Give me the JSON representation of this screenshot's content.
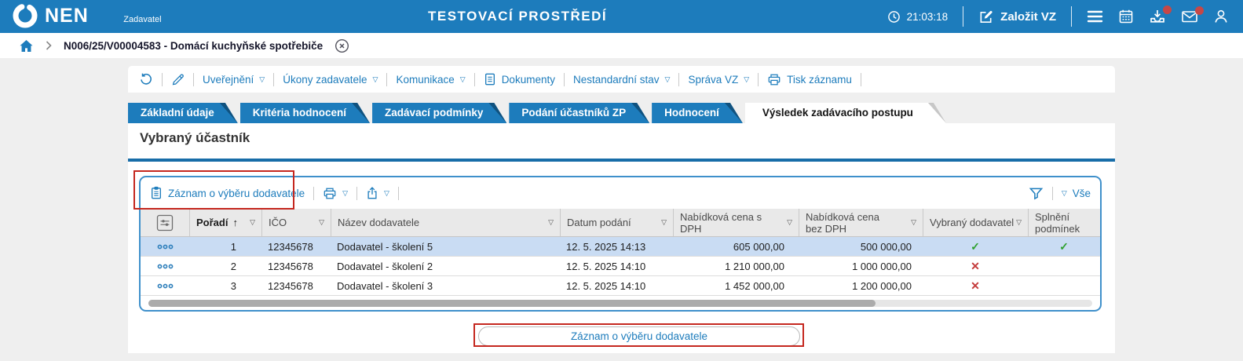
{
  "header": {
    "brand": "NEN",
    "brand_role": "Zadavatel",
    "environment": "TESTOVACÍ PROSTŘEDÍ",
    "clock": "21:03:18",
    "create_vz": "Založit VZ"
  },
  "breadcrumb": {
    "label": "N006/25/V00004583 - Domácí kuchyňské spotřebiče"
  },
  "actions": {
    "uverejneni": "Uveřejnění",
    "ukony_zadavatele": "Úkony zadavatele",
    "komunikace": "Komunikace",
    "dokumenty": "Dokumenty",
    "nestandardni_stav": "Nestandardní stav",
    "sprava_vz": "Správa VZ",
    "tisk_zaznamu": "Tisk záznamu"
  },
  "tabs": [
    {
      "label": "Základní údaje",
      "active": false
    },
    {
      "label": "Kritéria hodnocení",
      "active": false
    },
    {
      "label": "Zadávací podmínky",
      "active": false
    },
    {
      "label": "Podání účastníků ZP",
      "active": false
    },
    {
      "label": "Hodnocení",
      "active": false
    },
    {
      "label": "Výsledek zadávacího postupu",
      "active": true
    }
  ],
  "section": {
    "title": "Vybraný účastník"
  },
  "grid": {
    "record_button": "Záznam o výběru dodavatele",
    "filter_all": "Vše",
    "columns": {
      "poradi": "Pořadí",
      "ico": "IČO",
      "nazev": "Název dodavatele",
      "datum": "Datum podání",
      "cena_s_dph": "Nabídková cena s DPH",
      "cena_bez_dph": "Nabídková cena bez DPH",
      "vybrany": "Vybraný dodavatel",
      "splneni": "Splnění podmínek"
    },
    "sort_column": "Pořadí",
    "sort_direction": "asc",
    "rows": [
      {
        "poradi": "1",
        "ico": "12345678",
        "nazev": "Dodavatel - školení 5",
        "datum": "12. 5. 2025 14:13",
        "cena_s_dph": "605 000,00",
        "cena_bez_dph": "500 000,00",
        "vybrany": "✓",
        "splneni": "✓",
        "selected": true
      },
      {
        "poradi": "2",
        "ico": "12345678",
        "nazev": "Dodavatel - školení 2",
        "datum": "12. 5. 2025 14:10",
        "cena_s_dph": "1 210 000,00",
        "cena_bez_dph": "1 000 000,00",
        "vybrany": "✕",
        "splneni": "",
        "selected": false
      },
      {
        "poradi": "3",
        "ico": "12345678",
        "nazev": "Dodavatel - školení 3",
        "datum": "12. 5. 2025 14:10",
        "cena_s_dph": "1 452 000,00",
        "cena_bez_dph": "1 200 000,00",
        "vybrany": "✕",
        "splneni": "",
        "selected": false
      }
    ]
  },
  "footer": {
    "record_button": "Záznam o výběru dodavatele"
  },
  "icons": {
    "caret": "▽",
    "sort_asc": "↑"
  },
  "colors": {
    "primary_blue": "#1d7cbc",
    "tab_fold": "#10527f",
    "rule_blue": "#186da8",
    "panel_border": "#3f90cb",
    "selected_row": "#c9dcf3",
    "annotation_red": "#c5271f",
    "ok_green": "#2fa12f",
    "error_red": "#c43b3b",
    "badge_red": "#c64747"
  }
}
